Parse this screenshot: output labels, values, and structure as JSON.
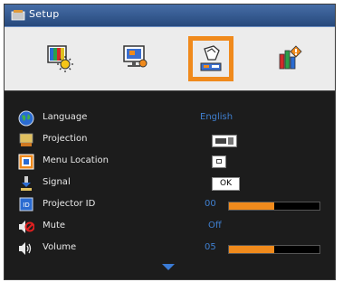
{
  "window": {
    "title": "Setup"
  },
  "tabs": [
    {
      "name": "image-settings",
      "active": false
    },
    {
      "name": "display-settings",
      "active": false
    },
    {
      "name": "setup",
      "active": true
    },
    {
      "name": "options",
      "active": false
    }
  ],
  "rows": [
    {
      "label": "Language",
      "value": "English"
    },
    {
      "label": "Projection",
      "value_icon": "projection-mode-icon"
    },
    {
      "label": "Menu Location",
      "value_icon": "menu-location-icon"
    },
    {
      "label": "Signal",
      "button": "OK"
    },
    {
      "label": "Projector ID",
      "value": "00",
      "level": 0.5
    },
    {
      "label": "Mute",
      "value": "Off"
    },
    {
      "label": "Volume",
      "value": "05",
      "level": 0.5
    }
  ],
  "colors": {
    "accent": "#f08a1c",
    "value_text": "#3f7fcf",
    "title_bar": "#2f5592"
  }
}
